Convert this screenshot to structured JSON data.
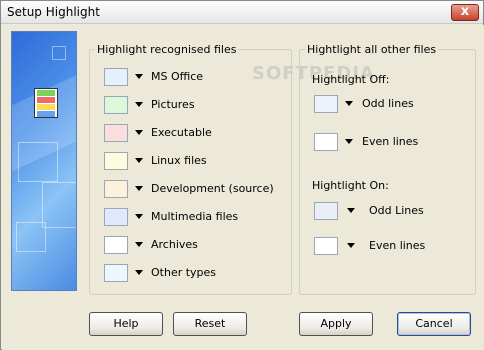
{
  "window": {
    "title": "Setup Highlight",
    "close_glyph": "x"
  },
  "recognised": {
    "title": "Highlight recognised files",
    "items": [
      {
        "label": "MS Office",
        "color": "#e4f1fb"
      },
      {
        "label": "Pictures",
        "color": "#dcf7dc"
      },
      {
        "label": "Executable",
        "color": "#fbdede"
      },
      {
        "label": "Linux files",
        "color": "#fdfbdc"
      },
      {
        "label": "Development (source)",
        "color": "#fdf1dc"
      },
      {
        "label": "Multimedia files",
        "color": "#e1e8fb"
      },
      {
        "label": "Archives",
        "color": "#ffffff"
      },
      {
        "label": "Other types",
        "color": "#eef6fd"
      }
    ]
  },
  "other": {
    "title": "Hightlight all other files",
    "off": {
      "title": "Hightlight Off:",
      "items": [
        {
          "label": "Odd lines",
          "color": "#eef2fb"
        },
        {
          "label": "Even lines",
          "color": "#ffffff"
        }
      ]
    },
    "on": {
      "title": "Hightlight On:",
      "items": [
        {
          "label": "Odd Lines",
          "color": "#e9eef9"
        },
        {
          "label": "Even lines",
          "color": "#ffffff"
        }
      ]
    }
  },
  "buttons": {
    "help": "Help",
    "reset": "Reset",
    "apply": "Apply",
    "cancel": "Cancel"
  },
  "watermark": "SOFTPEDIA"
}
